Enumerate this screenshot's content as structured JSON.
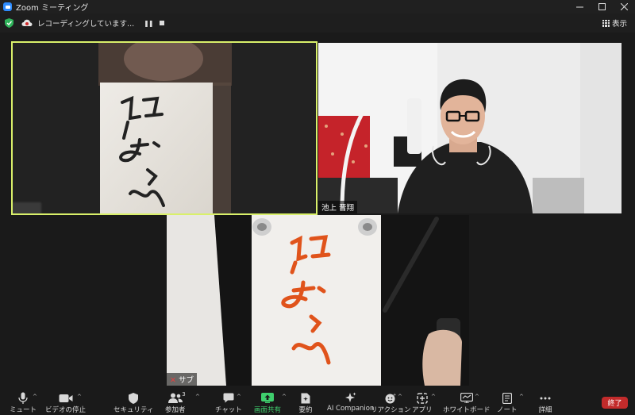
{
  "window": {
    "title": "Zoom ミーティング"
  },
  "infobar": {
    "recording_text": "レコーディングしています...",
    "view_label": "表示"
  },
  "participants": [
    {
      "name": ""
    },
    {
      "name": "池上 晋翔"
    },
    {
      "name": "サブ"
    }
  ],
  "toolbar": {
    "mute_label": "ミュート",
    "video_label": "ビデオの停止",
    "security_label": "セキュリティ",
    "participants_label": "参加者",
    "participants_count": "3",
    "chat_label": "チャット",
    "share_label": "画面共有",
    "summary_label": "要約",
    "ai_label": "AI Companion",
    "reactions_label": "リアクション",
    "apps_label": "アプリ",
    "whiteboard_label": "ホワイトボード",
    "notes_label": "ノート",
    "more_label": "詳細",
    "end_label": "終了"
  },
  "colors": {
    "active_speaker_border": "#d9f06a",
    "share_green": "#3fce6d",
    "end_red": "#c22b2b",
    "brush_ink": "#e0531b"
  }
}
